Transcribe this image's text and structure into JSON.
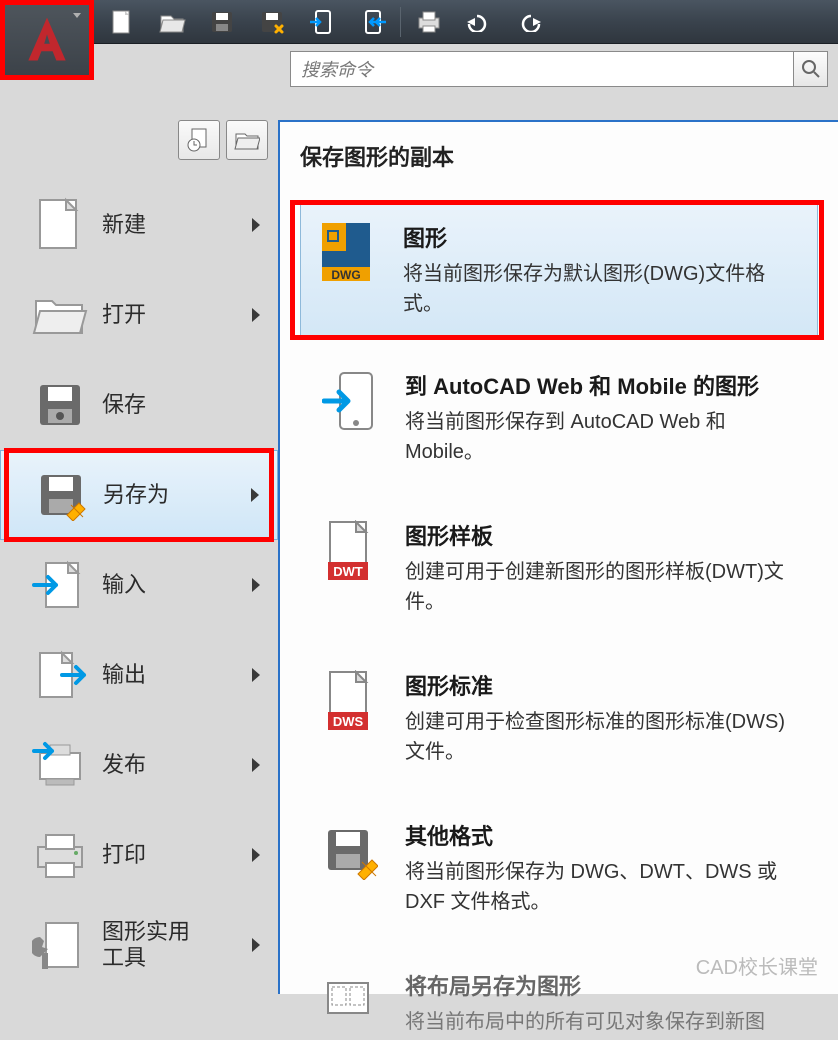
{
  "search": {
    "placeholder": "搜索命令"
  },
  "menu": {
    "new": "新建",
    "open": "打开",
    "save": "保存",
    "saveas": "另存为",
    "import": "输入",
    "export": "输出",
    "publish": "发布",
    "print": "打印",
    "utils": "图形实用\n工具"
  },
  "panel": {
    "title": "保存图形的副本",
    "items": [
      {
        "title": "图形",
        "desc": "将当前图形保存为默认图形(DWG)文件格式。"
      },
      {
        "title": "到 AutoCAD Web 和 Mobile 的图形",
        "desc": "将当前图形保存到 AutoCAD Web 和 Mobile。"
      },
      {
        "title": "图形样板",
        "desc": "创建可用于创建新图形的图形样板(DWT)文件。"
      },
      {
        "title": "图形标准",
        "desc": "创建可用于检查图形标准的图形标准(DWS)文件。"
      },
      {
        "title": "其他格式",
        "desc": "将当前图形保存为 DWG、DWT、DWS 或 DXF 文件格式。"
      },
      {
        "title": "将布局另存为图形",
        "desc": "将当前布局中的所有可见对象保存到新图"
      }
    ],
    "file_badges": {
      "dwg": "DWG",
      "dwt": "DWT",
      "dws": "DWS"
    }
  },
  "watermark": "CAD校长课堂"
}
